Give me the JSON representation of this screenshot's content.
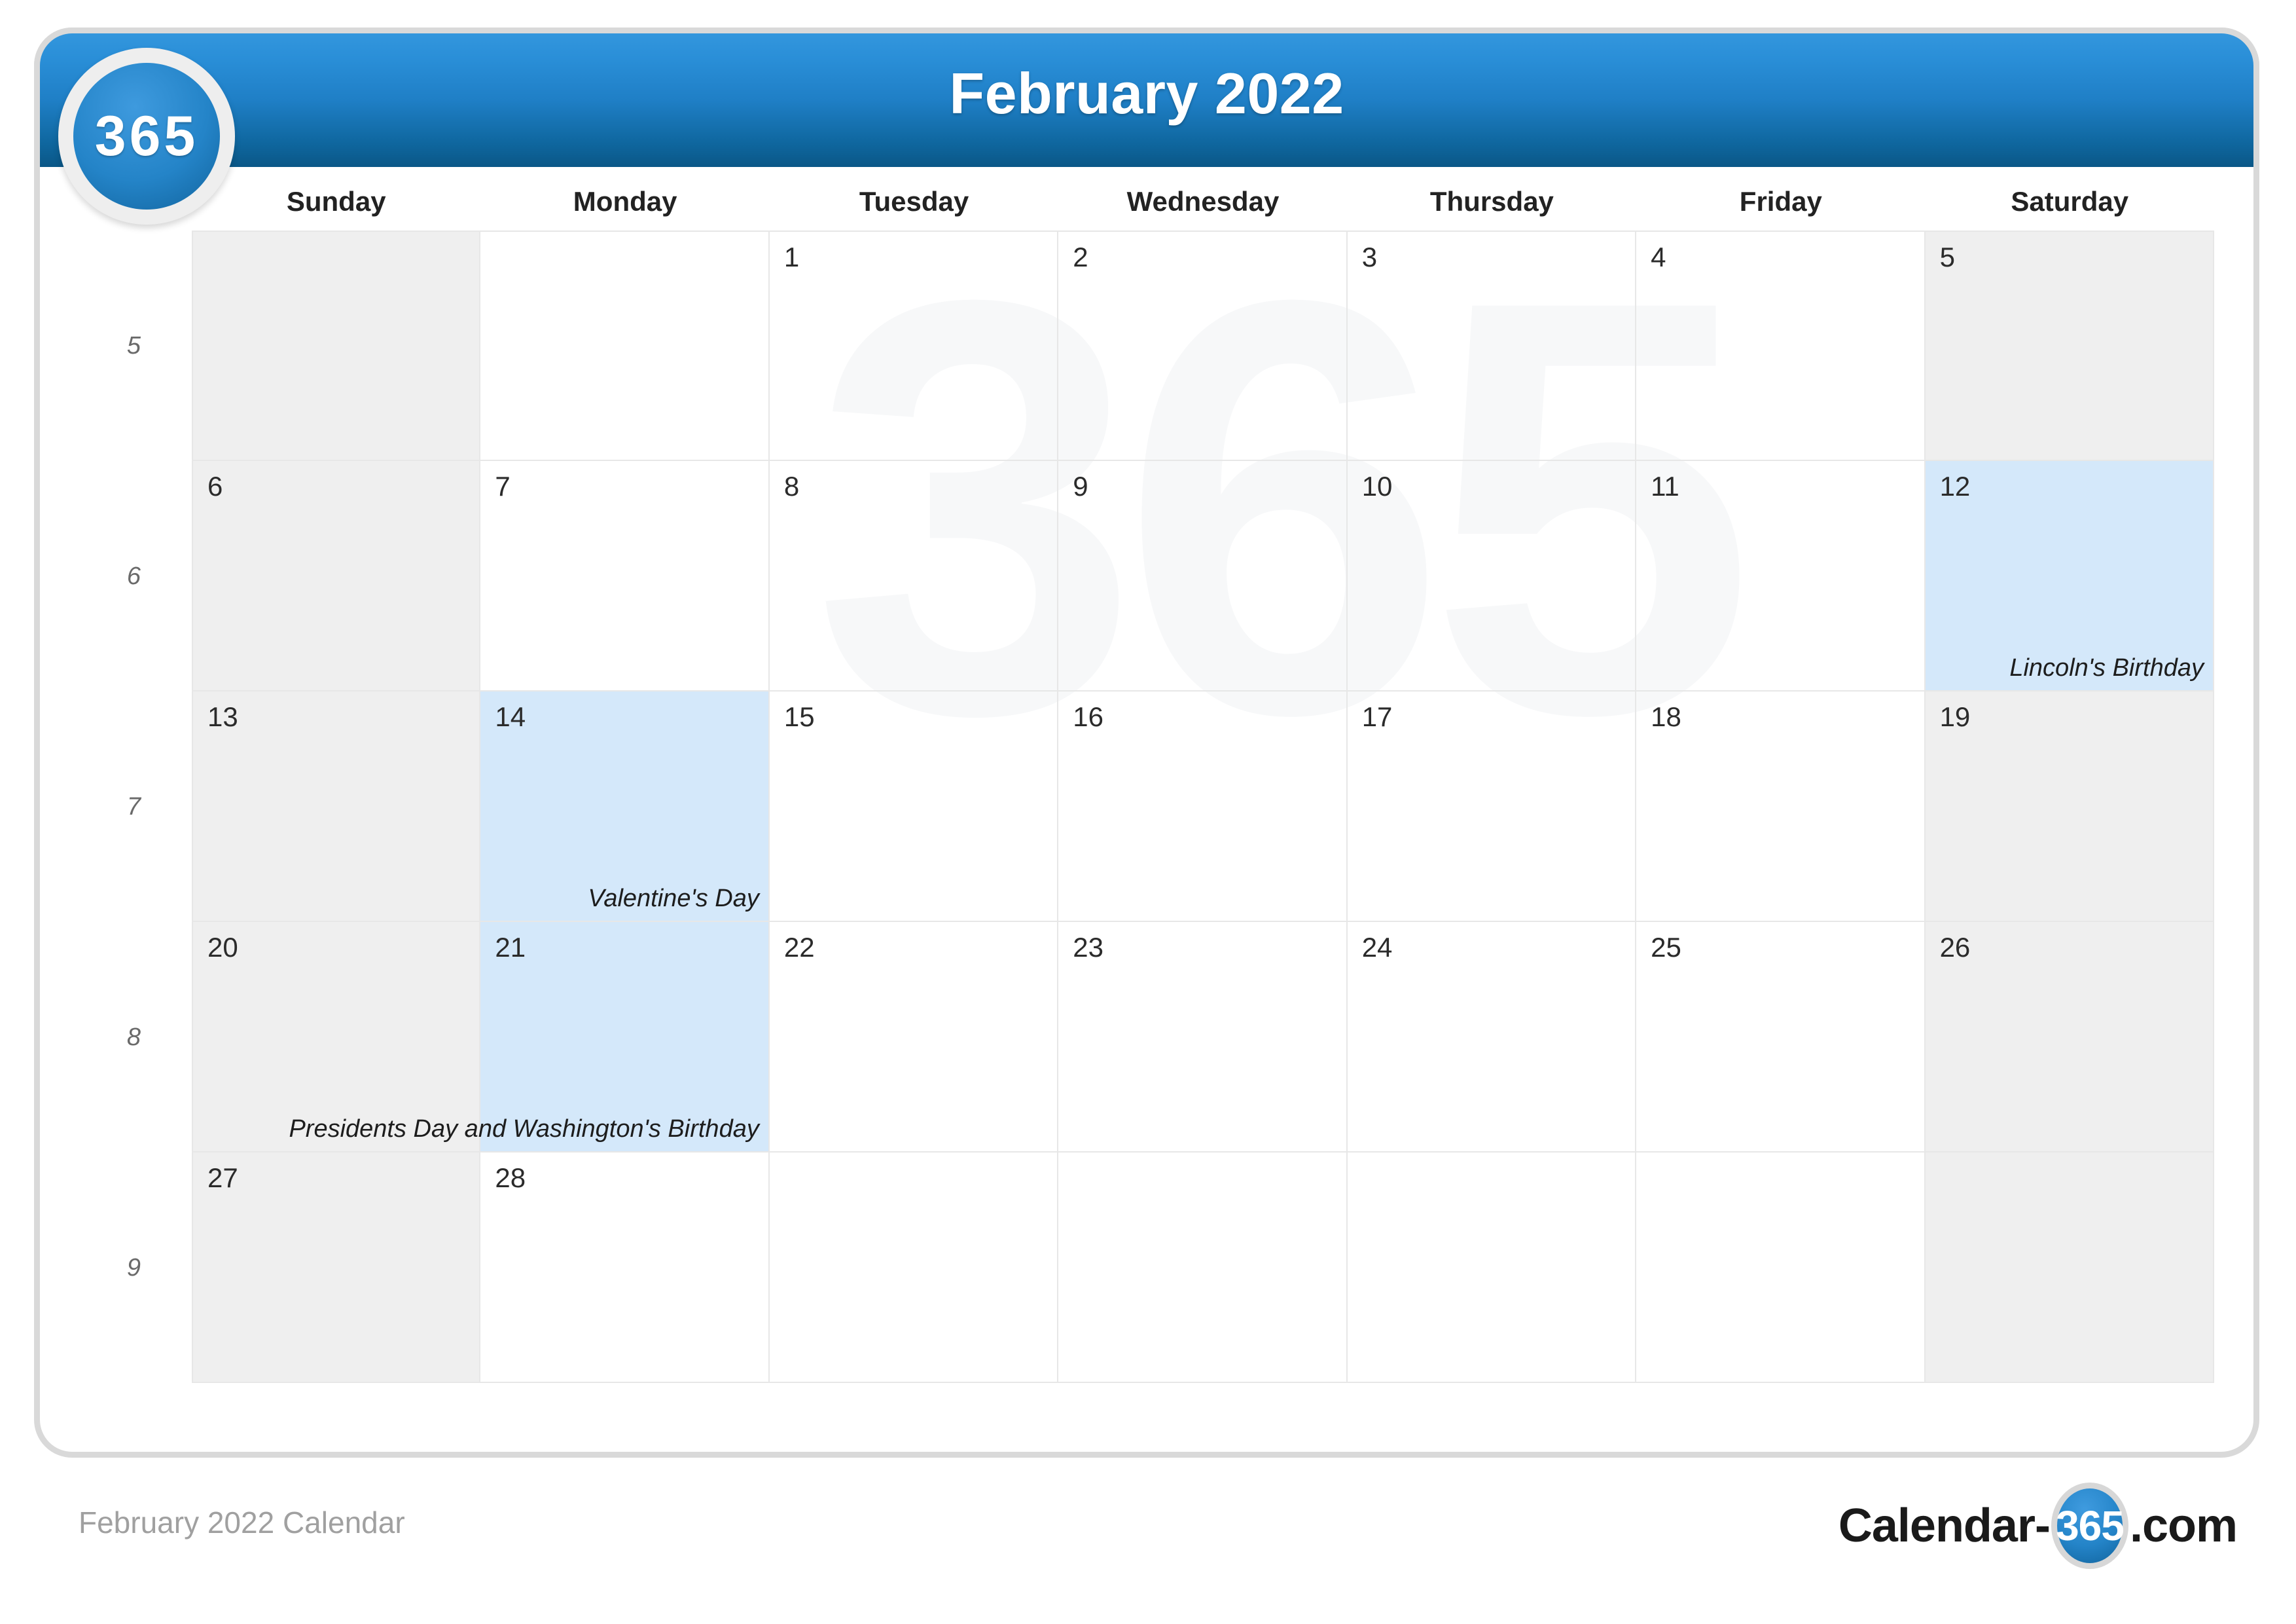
{
  "header": {
    "title": "February 2022",
    "badge_text": "365"
  },
  "colors": {
    "header_gradient_top": "#3396dd",
    "header_gradient_bottom": "#0a5787",
    "weekend_bg": "#efefef",
    "holiday_bg": "#d4e8fa",
    "grid_line": "#e7e7e7",
    "card_border": "#d9d9d9",
    "footer_caption": "#a0a0a0",
    "week_number": "#6a6a6a"
  },
  "watermark": {
    "text": "365"
  },
  "weekdays": [
    "Sunday",
    "Monday",
    "Tuesday",
    "Wednesday",
    "Thursday",
    "Friday",
    "Saturday"
  ],
  "week_numbers": [
    "5",
    "6",
    "7",
    "8",
    "9"
  ],
  "weeks": [
    {
      "week_number": "5",
      "days": [
        {
          "number": "",
          "event": "",
          "weekend": true,
          "holiday": false,
          "blank": true
        },
        {
          "number": "",
          "event": "",
          "weekend": false,
          "holiday": false,
          "blank": true
        },
        {
          "number": "1",
          "event": "",
          "weekend": false,
          "holiday": false,
          "blank": false
        },
        {
          "number": "2",
          "event": "",
          "weekend": false,
          "holiday": false,
          "blank": false
        },
        {
          "number": "3",
          "event": "",
          "weekend": false,
          "holiday": false,
          "blank": false
        },
        {
          "number": "4",
          "event": "",
          "weekend": false,
          "holiday": false,
          "blank": false
        },
        {
          "number": "5",
          "event": "",
          "weekend": true,
          "holiday": false,
          "blank": false
        }
      ]
    },
    {
      "week_number": "6",
      "days": [
        {
          "number": "6",
          "event": "",
          "weekend": true,
          "holiday": false,
          "blank": false
        },
        {
          "number": "7",
          "event": "",
          "weekend": false,
          "holiday": false,
          "blank": false
        },
        {
          "number": "8",
          "event": "",
          "weekend": false,
          "holiday": false,
          "blank": false
        },
        {
          "number": "9",
          "event": "",
          "weekend": false,
          "holiday": false,
          "blank": false
        },
        {
          "number": "10",
          "event": "",
          "weekend": false,
          "holiday": false,
          "blank": false
        },
        {
          "number": "11",
          "event": "",
          "weekend": false,
          "holiday": false,
          "blank": false
        },
        {
          "number": "12",
          "event": "Lincoln's Birthday",
          "weekend": true,
          "holiday": true,
          "blank": false
        }
      ]
    },
    {
      "week_number": "7",
      "days": [
        {
          "number": "13",
          "event": "",
          "weekend": true,
          "holiday": false,
          "blank": false
        },
        {
          "number": "14",
          "event": "Valentine's Day",
          "weekend": false,
          "holiday": true,
          "blank": false
        },
        {
          "number": "15",
          "event": "",
          "weekend": false,
          "holiday": false,
          "blank": false
        },
        {
          "number": "16",
          "event": "",
          "weekend": false,
          "holiday": false,
          "blank": false
        },
        {
          "number": "17",
          "event": "",
          "weekend": false,
          "holiday": false,
          "blank": false
        },
        {
          "number": "18",
          "event": "",
          "weekend": false,
          "holiday": false,
          "blank": false
        },
        {
          "number": "19",
          "event": "",
          "weekend": true,
          "holiday": false,
          "blank": false
        }
      ]
    },
    {
      "week_number": "8",
      "days": [
        {
          "number": "20",
          "event": "",
          "weekend": true,
          "holiday": false,
          "blank": false
        },
        {
          "number": "21",
          "event": "Presidents Day and Washington's Birthday",
          "weekend": false,
          "holiday": true,
          "blank": false
        },
        {
          "number": "22",
          "event": "",
          "weekend": false,
          "holiday": false,
          "blank": false
        },
        {
          "number": "23",
          "event": "",
          "weekend": false,
          "holiday": false,
          "blank": false
        },
        {
          "number": "24",
          "event": "",
          "weekend": false,
          "holiday": false,
          "blank": false
        },
        {
          "number": "25",
          "event": "",
          "weekend": false,
          "holiday": false,
          "blank": false
        },
        {
          "number": "26",
          "event": "",
          "weekend": true,
          "holiday": false,
          "blank": false
        }
      ]
    },
    {
      "week_number": "9",
      "days": [
        {
          "number": "27",
          "event": "",
          "weekend": true,
          "holiday": false,
          "blank": false
        },
        {
          "number": "28",
          "event": "",
          "weekend": false,
          "holiday": false,
          "blank": false
        },
        {
          "number": "",
          "event": "",
          "weekend": false,
          "holiday": false,
          "blank": true
        },
        {
          "number": "",
          "event": "",
          "weekend": false,
          "holiday": false,
          "blank": true
        },
        {
          "number": "",
          "event": "",
          "weekend": false,
          "holiday": false,
          "blank": true
        },
        {
          "number": "",
          "event": "",
          "weekend": false,
          "holiday": false,
          "blank": true
        },
        {
          "number": "",
          "event": "",
          "weekend": true,
          "holiday": false,
          "blank": true
        }
      ]
    }
  ],
  "footer": {
    "caption": "February 2022 Calendar",
    "logo_left": "Calendar-",
    "logo_badge": "365",
    "logo_right": ".com"
  }
}
